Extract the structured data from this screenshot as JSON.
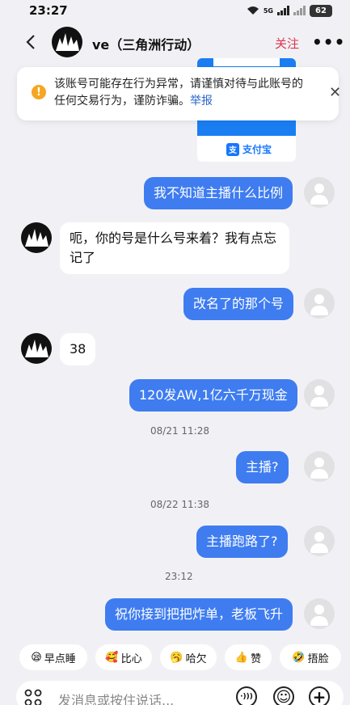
{
  "status": {
    "time": "23:27",
    "net": "5G",
    "battery": "62"
  },
  "header": {
    "title": "ve（三角洲行动）",
    "follow": "关注",
    "more": "•••"
  },
  "qr_card": {
    "brand": "支付宝",
    "brand_logo_char": "支"
  },
  "warning": {
    "text": "该账号可能存在行为异常，请谨慎对待与此账号的任何交易行为，谨防诈骗。",
    "link": "举报",
    "icon_char": "!",
    "close": "✕"
  },
  "messages": [
    {
      "side": "out",
      "text": "我不知道主播什么比例"
    },
    {
      "side": "in",
      "text": "呃，你的号是什么号来着？我有点忘记了"
    },
    {
      "side": "out",
      "text": "改名了的那个号"
    },
    {
      "side": "in",
      "text": "38"
    },
    {
      "side": "out",
      "text": "120发AW,1亿六千万现金"
    },
    {
      "side": "out",
      "text": "主播?"
    },
    {
      "side": "out",
      "text": "主播跑路了?"
    },
    {
      "side": "out",
      "text": "祝你接到把把炸单，老板飞升"
    }
  ],
  "timestamps": [
    "08/21 11:28",
    "08/22 11:38",
    "23:12"
  ],
  "quick_replies": [
    {
      "emoji": "😪",
      "label": "早点睡"
    },
    {
      "emoji": "🥰",
      "label": "比心"
    },
    {
      "emoji": "🥱",
      "label": "哈欠"
    },
    {
      "emoji": "👍",
      "label": "赞"
    },
    {
      "emoji": "🤣",
      "label": "捂脸"
    }
  ],
  "input": {
    "placeholder": "发消息或按住说话...",
    "voice_icon": "·)))",
    "emoji_icon": "☺",
    "plus_icon": "+"
  },
  "colors": {
    "accent": "#3e7cf0",
    "follow": "#e0344b",
    "warn": "#f5a623",
    "alipay": "#1677ff"
  },
  "icons": [
    "back-arrow-icon",
    "more-icon",
    "warning-icon",
    "close-icon",
    "grid-icon",
    "voice-icon",
    "emoji-icon",
    "plus-icon"
  ]
}
